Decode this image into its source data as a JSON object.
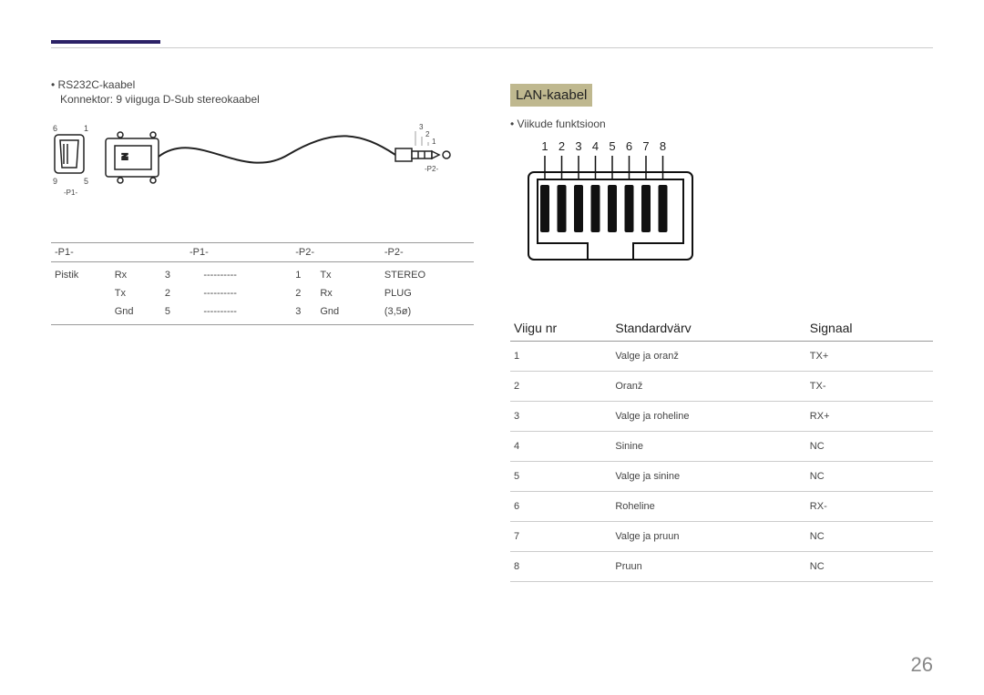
{
  "page_number": "26",
  "left": {
    "bullet": "RS232C-kaabel",
    "subline": "Konnektor: 9 viiguga D-Sub stereokaabel",
    "diagram": {
      "p1_label": "-P1-",
      "p2_label": "-P2-",
      "dsub_top_left": "6",
      "dsub_top_right": "1",
      "dsub_bot_left": "9",
      "dsub_bot_right": "5",
      "trs_1": "3",
      "trs_2": "2",
      "trs_3": "1"
    },
    "table": {
      "headers": [
        "-P1-",
        "",
        "",
        "-P1-",
        "",
        "",
        "-P2-",
        "",
        "",
        "-P2-"
      ],
      "rows": [
        [
          "Pistik",
          "Rx",
          "3",
          "",
          "----------",
          "",
          "1",
          "Tx",
          "",
          "STEREO"
        ],
        [
          "",
          "Tx",
          "2",
          "",
          "----------",
          "",
          "2",
          "Rx",
          "",
          "PLUG"
        ],
        [
          "",
          "Gnd",
          "5",
          "",
          "----------",
          "",
          "3",
          "Gnd",
          "",
          "(3,5ø)"
        ]
      ]
    }
  },
  "right": {
    "heading": "LAN-kaabel",
    "bullet": "Viikude funktsioon",
    "pin_labels": [
      "1",
      "2",
      "3",
      "4",
      "5",
      "6",
      "7",
      "8"
    ],
    "table": {
      "headers": [
        "Viigu nr",
        "Standardvärv",
        "Signaal"
      ],
      "rows": [
        [
          "1",
          "Valge ja oranž",
          "TX+"
        ],
        [
          "2",
          "Oranž",
          "TX-"
        ],
        [
          "3",
          "Valge ja roheline",
          "RX+"
        ],
        [
          "4",
          "Sinine",
          "NC"
        ],
        [
          "5",
          "Valge ja sinine",
          "NC"
        ],
        [
          "6",
          "Roheline",
          "RX-"
        ],
        [
          "7",
          "Valge ja pruun",
          "NC"
        ],
        [
          "8",
          "Pruun",
          "NC"
        ]
      ]
    }
  }
}
